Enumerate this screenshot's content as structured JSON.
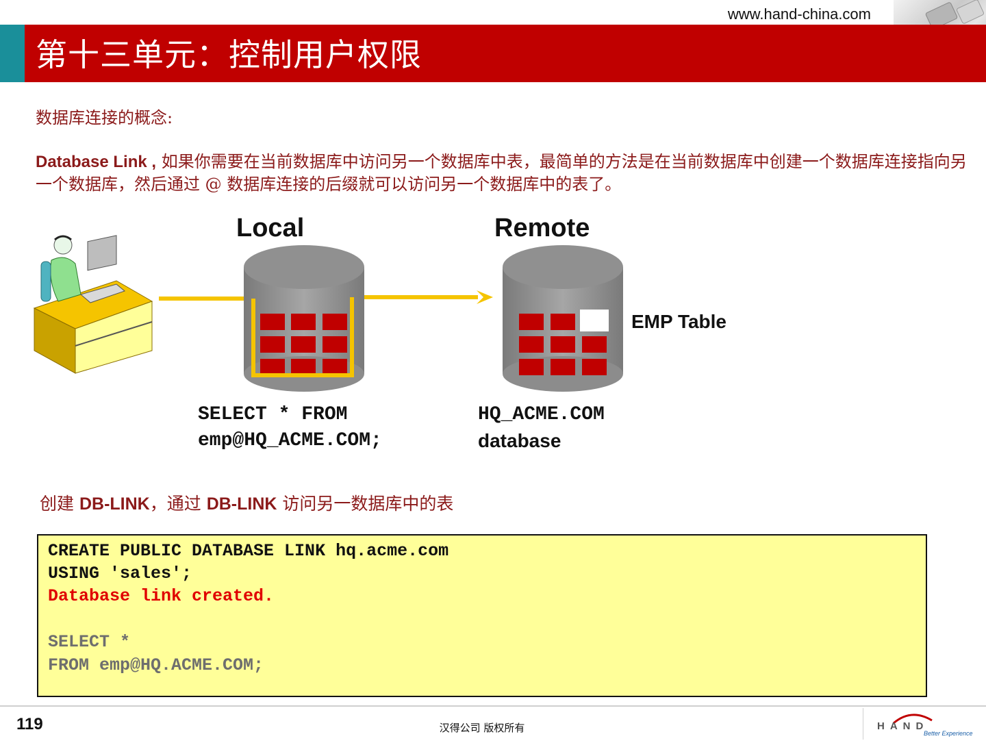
{
  "header": {
    "site_url": "www.hand-china.com",
    "title": "第十三单元：控制用户权限",
    "title_bar_color": "#c00000",
    "accent_color": "#1a8f9a"
  },
  "content": {
    "concept_heading": "数据库连接的概念:",
    "para_term": "Database Link ,",
    "para_text": "如果你需要在当前数据库中访问另一个数据库中表，最简单的方法是在当前数据库中创建一个数据库连接指向另一个数据库，然后通过 @ 数据库连接的后缀就可以访问另一个数据库中的表了。"
  },
  "diagram": {
    "local_label": "Local",
    "remote_label": "Remote",
    "emp_table_label": "EMP Table",
    "query_line1": "SELECT * FROM",
    "query_line2": "emp@HQ_ACME.COM;",
    "remote_db_line1": "HQ_ACME.COM",
    "remote_db_line2": "database",
    "icons": [
      "user-at-computer-icon",
      "local-database-icon",
      "remote-database-icon",
      "link-arrow-icon"
    ]
  },
  "create_section": {
    "prefix": "创建",
    "term1": "DB-LINK",
    "middle": "，通过",
    "term2": "DB-LINK",
    "suffix": "访问另一数据库中的表"
  },
  "code": {
    "line1": "CREATE PUBLIC DATABASE LINK hq.acme.com",
    "line2": "USING 'sales';",
    "line3": "Database link created.",
    "line4": "SELECT *",
    "line5": "FROM emp@HQ.ACME.COM;"
  },
  "footer": {
    "page_number": "119",
    "copyright": "汉得公司 版权所有",
    "logo_text": "HAND",
    "logo_tagline": "Better Experience"
  }
}
